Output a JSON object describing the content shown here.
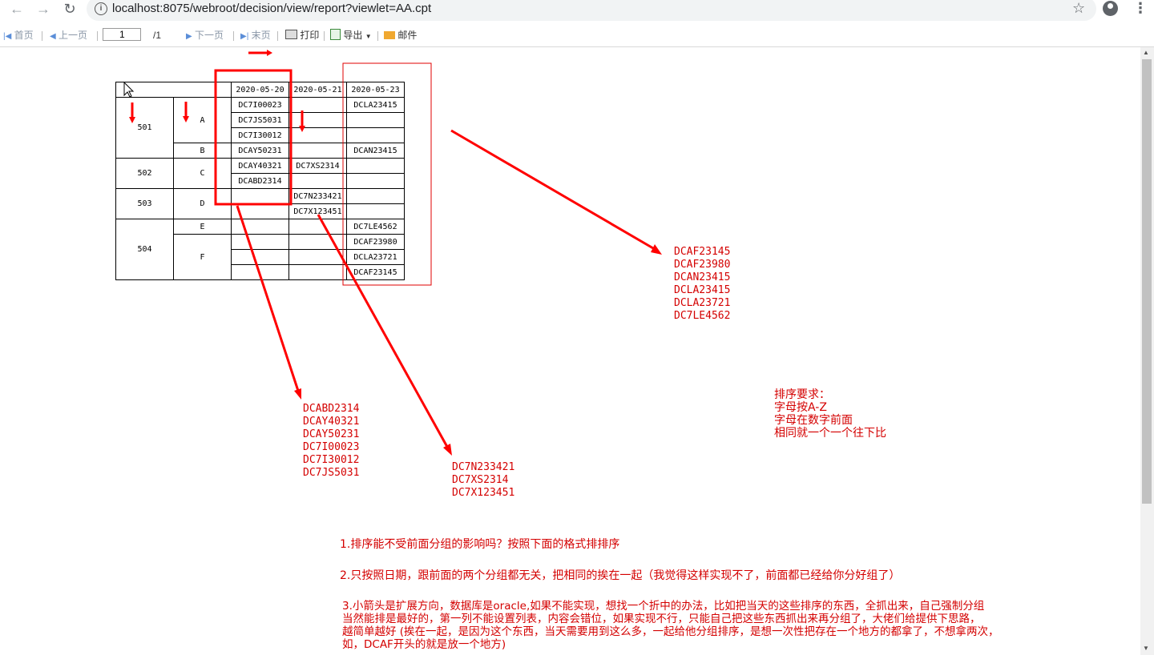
{
  "browser": {
    "url": "localhost:8075/webroot/decision/view/report?viewlet=AA.cpt"
  },
  "toolbar": {
    "first": "首页",
    "prev": "上一页",
    "page_value": "1",
    "page_total": "/1",
    "next": "下一页",
    "last": "末页",
    "print": "打印",
    "export": "导出",
    "mail": "邮件"
  },
  "report": {
    "dates": [
      "2020-05-20",
      "2020-05-21",
      "2020-05-23"
    ],
    "groups": [
      "501",
      "502",
      "503",
      "504"
    ],
    "subgroups": [
      "A",
      "B",
      "C",
      "D",
      "E",
      "F"
    ],
    "cells": {
      "r1c1": "DC7I00023",
      "r1c3": "DCLA23415",
      "r2c1": "DC7JS5031",
      "r3c1": "DC7I30012",
      "r4c1": "DCAY50231",
      "r4c3": "DCAN23415",
      "r5c1": "DCAY40321",
      "r5c2": "DC7XS2314",
      "r6c1": "DCABD2314",
      "r7c2": "DC7N233421",
      "r8c2": "DC7X123451",
      "r9c3": "DC7LE4562",
      "r10c3": "DCAF23980",
      "r11c3": "DCLA23721",
      "r12c3": "DCAF23145"
    }
  },
  "annotations": {
    "list_col1": [
      "DCABD2314",
      "DCAY40321",
      "DCAY50231",
      "DC7I00023",
      "DC7I30012",
      "DC7JS5031"
    ],
    "list_col2": [
      "DC7N233421",
      "DC7XS2314",
      "DC7X123451"
    ],
    "list_col3": [
      "DCAF23145",
      "DCAF23980",
      "DCAN23415",
      "DCLA23415",
      "DCLA23721",
      "DC7LE4562"
    ],
    "sort_rules": [
      "排序要求：",
      "字母按A-Z",
      "字母在数字前面",
      "相同就一个一个往下比"
    ],
    "q1": "1.排序能不受前面分组的影响吗？按照下面的格式排排序",
    "q2": "2.只按照日期，跟前面的两个分组都无关，把相同的挨在一起（我觉得这样实现不了，前面都已经给你分好组了）",
    "q3": [
      "3.小箭头是扩展方向，数据库是oracle,如果不能实现，想找一个折中的办法，比如把当天的这些排序的东西，全抓出来，自己强制分组",
      "当然能排是最好的，第一列不能设置列表，内容会错位，如果实现不行，只能自己把这些东西抓出来再分组了，大佬们给提供下思路，",
      "越简单越好  (挨在一起，是因为这个东西，当天需要用到这么多，一起给他分组排序，是想一次性把存在一个地方的都拿了，不想拿两次，",
      "如，DCAF开头的就是放一个地方)"
    ]
  },
  "colors": {
    "annotation": "#d40000",
    "toolbar_disabled": "#8a97a7"
  }
}
